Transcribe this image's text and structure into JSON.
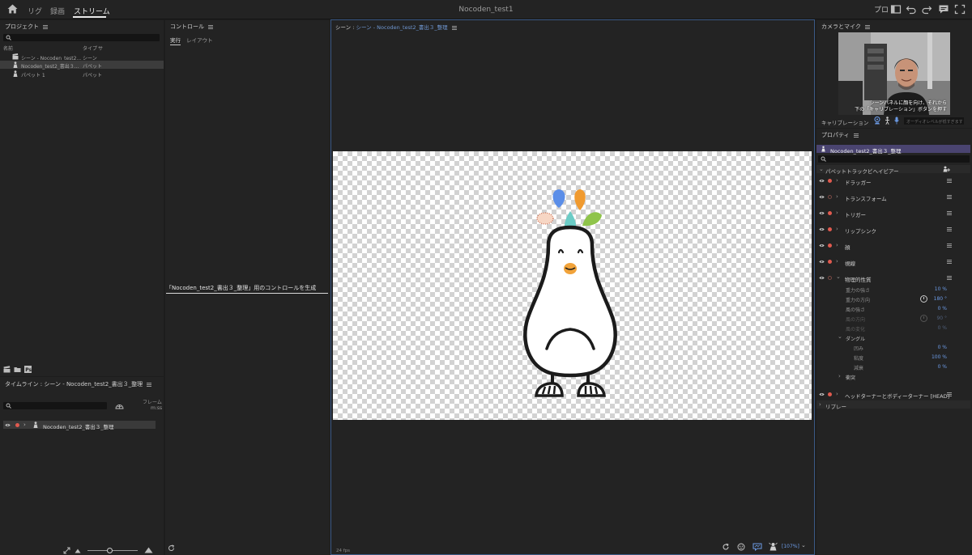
{
  "topbar": {
    "tabs": [
      "リグ",
      "録画",
      "ストリーム"
    ],
    "active_tab": "ストリーム",
    "title": "Nocoden_test1",
    "right_label": "プロ"
  },
  "project": {
    "title": "プロジェクト",
    "col_name": "名前",
    "col_type": "タイプ",
    "col_extra": "サ",
    "items": [
      {
        "name": "シーン - Nocoden_test2...",
        "type": "シーン",
        "icon": "scene-icon"
      },
      {
        "name": "Nocoden_test2_書出３...",
        "type": "パペット",
        "icon": "puppet-icon"
      },
      {
        "name": "パペット 1",
        "type": "パペット",
        "icon": "puppet-icon"
      }
    ]
  },
  "controls": {
    "title": "コントロール",
    "tab_run": "実行",
    "tab_layout": "レイアウト",
    "message": "「Nocoden_test2_書出３_整理」用のコントロールを生成"
  },
  "scene": {
    "prefix": "シーン : ",
    "name": "シーン - Nocoden_test2_書出３_整理",
    "fps": "24 fps",
    "zoom": "[107%]"
  },
  "timeline": {
    "title": "タイムライン : シーン - Nocoden_test2_書出３_整理",
    "frame_label": "フレーム",
    "time_label": "m:ss",
    "track_name": "Nocoden_test2_書出３_整理"
  },
  "camera": {
    "title": "カメラとマイク",
    "instruction_line1": "シーンパネルに顔を向け、それから",
    "instruction_line2": "下の「キャリブレーション」ボタンを押す",
    "calibrate_label": "キャリブレーション",
    "audio_label": "オーディオレベルが低すぎます"
  },
  "properties": {
    "title": "プロパティ",
    "puppet_name": "Nocoden_test2_書出３_整理",
    "section_label": "パペットトラックビヘイビアー",
    "behaviors": [
      "ドラッガー",
      "トランスフォーム",
      "トリガー",
      "リップシンク",
      "顔",
      "視線",
      "物理的性質"
    ],
    "physics_params": [
      {
        "label": "重力の強さ",
        "value": "10 %"
      },
      {
        "label": "重力の方向",
        "value": "180 °"
      },
      {
        "label": "風の強さ",
        "value": "0 %"
      },
      {
        "label": "風の方向",
        "value": "90 °"
      },
      {
        "label": "風の変化",
        "value": "0 %"
      }
    ],
    "dangle_label": "ダングル",
    "dangle_params": [
      {
        "label": "凹み",
        "value": "0 %"
      },
      {
        "label": "粘度",
        "value": "100 %"
      },
      {
        "label": "減衰",
        "value": "0 %"
      }
    ],
    "collision_label": "衝突",
    "head_turner_label": "ヘッドターナーとボディーターナー [HEAD]",
    "replay_label": "リプレー"
  },
  "colors": {
    "accent_blue": "#6c9be6",
    "record_red": "#e05a4f",
    "puppet_bar": "#4a4470"
  }
}
